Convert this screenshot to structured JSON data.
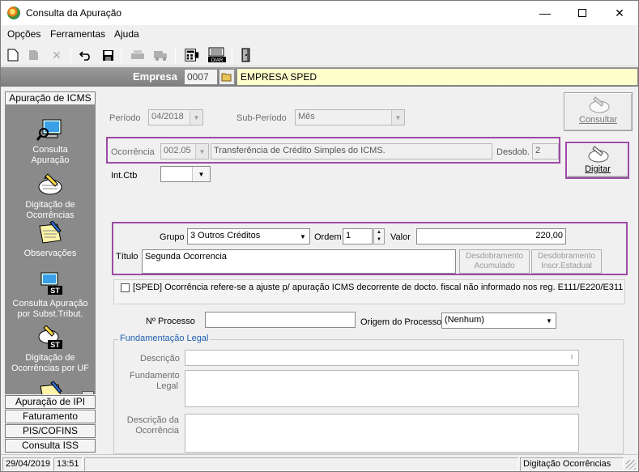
{
  "window": {
    "title": "Consulta da Apuração",
    "min": "—",
    "close": "✕"
  },
  "menu": [
    {
      "label": "Opções"
    },
    {
      "label": "Ferramentas"
    },
    {
      "label": "Ajuda"
    }
  ],
  "empresa": {
    "label": "Empresa",
    "code": "0007",
    "name": "EMPRESA SPED"
  },
  "sidebar": {
    "header": "Apuração de ICMS",
    "items": [
      {
        "label": "Consulta Apuração"
      },
      {
        "label": "Digitação de Ocorrências"
      },
      {
        "label": "Observações"
      },
      {
        "label": "Consulta  Apuração por Subst.Tribut."
      },
      {
        "label": "Digitação de Ocorrências por UF"
      }
    ],
    "sections": [
      {
        "label": "Apuração de IPI"
      },
      {
        "label": "Faturamento"
      },
      {
        "label": "PIS/COFINS"
      },
      {
        "label": "Consulta ISS"
      }
    ],
    "st_badge": "ST"
  },
  "form": {
    "periodo_label": "Período",
    "periodo_value": "04/2018",
    "subperiodo_label": "Sub-Período",
    "subperiodo_value": "Mês",
    "consultar_label": "Consultar",
    "ocorrencia_label": "Ocorrência",
    "ocorrencia_code": "002.05",
    "ocorrencia_desc": "Transferência de Crédito Simples do ICMS.",
    "desdob_label": "Desdob.",
    "desdob_value": "2",
    "digitar_label": "Digitar",
    "intctb_label": "Int.Ctb",
    "intctb_value": "",
    "grupo_label": "Grupo",
    "grupo_value": "3  Outros Créditos",
    "ordem_label": "Ordem",
    "ordem_value": "1",
    "valor_label": "Valor",
    "valor_value": "220,00",
    "titulo_label": "Título",
    "titulo_value": "Segunda Ocorrencia",
    "desdob_acumulado_label": "Desdobramento Acumulado",
    "desdob_inscr_label": "Desdobramento Inscr.Estadual",
    "sped_check_label": "[SPED] Ocorrência refere-se a ajuste p/ apuração ICMS decorrente de docto. fiscal não informado nos reg. E111/E220/E311",
    "nprocesso_label": "Nº Processo",
    "nprocesso_value": "",
    "origem_label": "Origem do Processo",
    "origem_value": "(Nenhum)",
    "fundamentacao_title": "Fundamentação Legal",
    "descricao_label": "Descrição",
    "fundamento_label": "Fundamento Legal",
    "descricao_ocorrencia_label": "Descrição da Ocorrência"
  },
  "status": {
    "date": "29/04/2019",
    "time": "13:51",
    "mode": "Digitação Ocorrências"
  }
}
